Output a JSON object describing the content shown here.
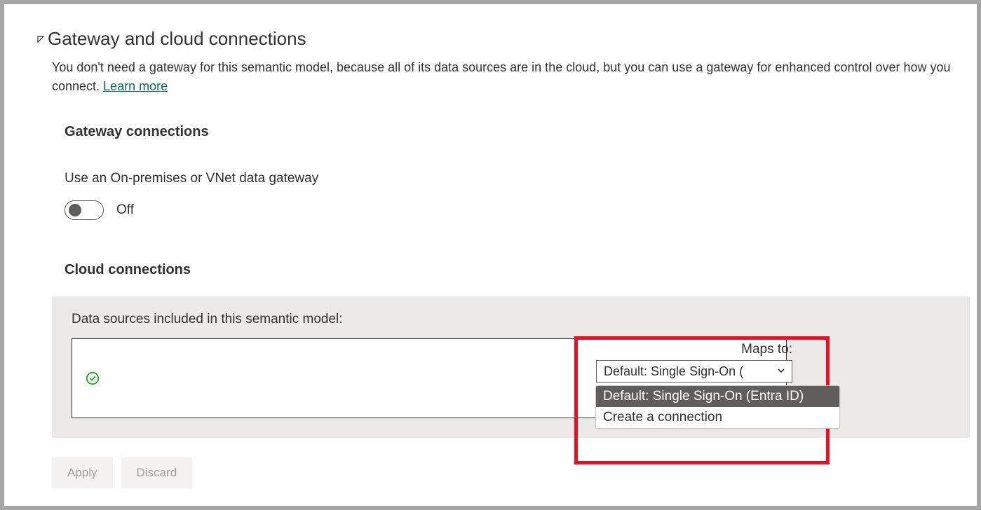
{
  "section": {
    "title": "Gateway and cloud connections",
    "description_prefix": "You don't need a gateway for this semantic model, because all of its data sources are in the cloud, but you can use a gateway for enhanced control over how you connect. ",
    "learn_more": "Learn more"
  },
  "gateway": {
    "title": "Gateway connections",
    "toggle_label": "Use an On-premises or VNet data gateway",
    "toggle_state": "Off"
  },
  "cloud": {
    "title": "Cloud connections",
    "panel_label": "Data sources included in this semantic model:",
    "maps_to_label": "Maps to:",
    "dropdown_selected": "Default: Single Sign-On (",
    "options": [
      "Default: Single Sign-On (Entra ID)",
      "Create a connection"
    ]
  },
  "buttons": {
    "apply": "Apply",
    "discard": "Discard"
  }
}
